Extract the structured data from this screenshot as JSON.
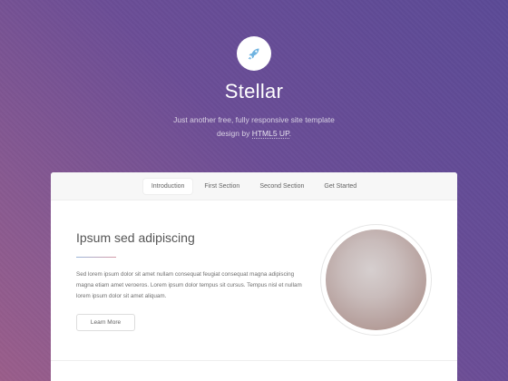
{
  "header": {
    "logo_icon": "rocket-icon",
    "title": "Stellar",
    "tagline_line1": "Just another free, fully responsive site template",
    "tagline_line2_prefix": "design by ",
    "tagline_link": "HTML5 UP",
    "tagline_line2_suffix": "."
  },
  "nav": {
    "items": [
      {
        "label": "Introduction",
        "active": true
      },
      {
        "label": "First Section",
        "active": false
      },
      {
        "label": "Second Section",
        "active": false
      },
      {
        "label": "Get Started",
        "active": false
      }
    ]
  },
  "intro": {
    "title": "Ipsum sed adipiscing",
    "paragraph": "Sed lorem ipsum dolor sit amet nullam consequat feugiat consequat magna adipiscing magna etiam amet veroeros. Lorem ipsum dolor tempus sit cursus. Tempus nisl et nullam lorem ipsum dolor sit amet aliquam.",
    "button_label": "Learn More"
  },
  "colors": {
    "background_start": "#5b4a96",
    "background_end": "#9a5d8a",
    "accent_line_start": "#9bb6d9",
    "accent_line_end": "#d49aa7",
    "logo_icon": "#6fb3e0"
  }
}
